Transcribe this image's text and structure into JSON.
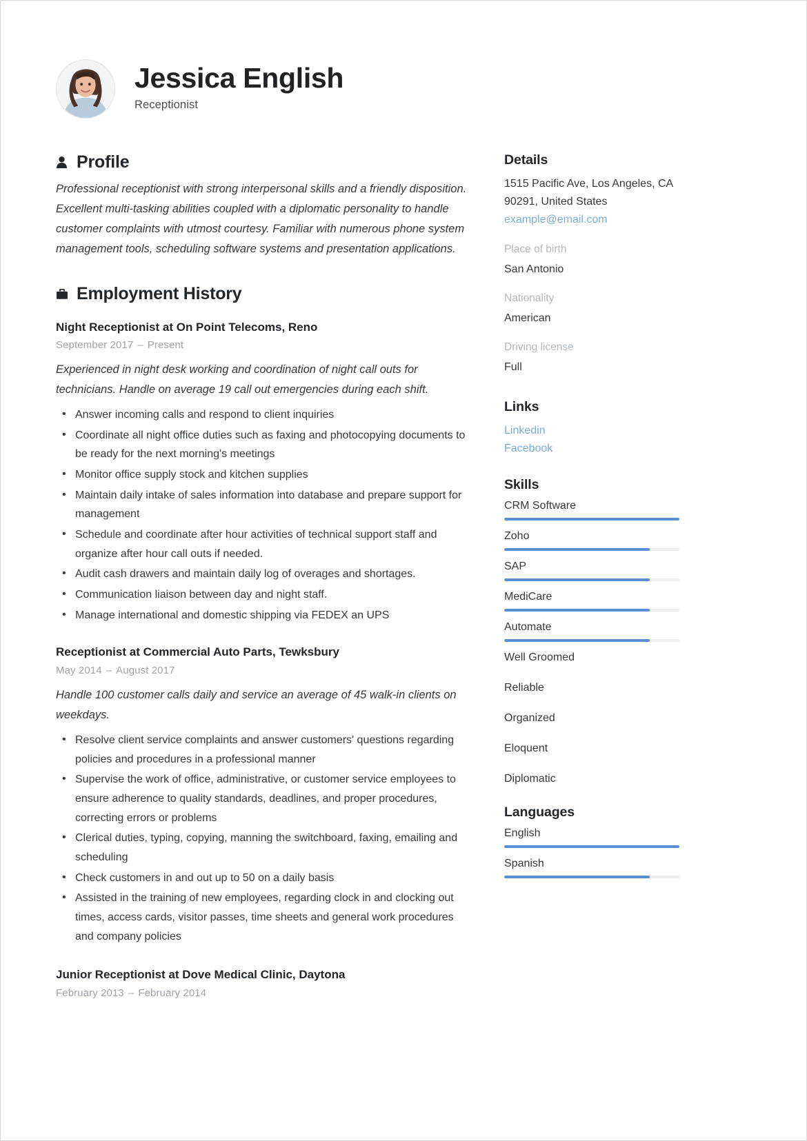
{
  "header": {
    "name": "Jessica English",
    "job_title": "Receptionist",
    "avatar_alt": "portrait-photo"
  },
  "profile": {
    "heading": "Profile",
    "icon": "person-icon",
    "text": "Professional receptionist with strong interpersonal skills and a friendly disposition. Excellent multi-tasking abilities coupled with a diplomatic personality to handle customer complaints with utmost courtesy. Familiar with numerous phone system management tools, scheduling software systems and presentation applications."
  },
  "employment": {
    "heading": "Employment History",
    "icon": "briefcase-icon",
    "jobs": [
      {
        "title": "Night Receptionist at On Point Telecoms, Reno",
        "start": "September 2017",
        "dash": "–",
        "end": "Present",
        "description": "Experienced in night desk working and coordination of night call outs for technicians. Handle on average 19 call out emergencies during each shift.",
        "duties": [
          "Answer incoming calls and respond to client inquiries",
          "Coordinate all night office duties such as faxing and photocopying documents to be ready for the next morning's meetings",
          "Monitor office supply stock and kitchen supplies",
          "Maintain daily intake of sales information into database and prepare support for management",
          "Schedule and coordinate after hour activities of technical support staff and organize after hour call outs if needed.",
          "Audit cash drawers and maintain daily log of overages and shortages.",
          "Communication liaison between day and night staff.",
          "Manage international and domestic shipping via FEDEX an UPS"
        ]
      },
      {
        "title": "Receptionist at Commercial Auto Parts, Tewksbury",
        "start": "May 2014",
        "dash": "–",
        "end": "August 2017",
        "description": "Handle 100 customer calls daily and service an average of 45 walk-in clients on weekdays.",
        "duties": [
          "Resolve client service complaints and answer customers' questions regarding policies and procedures in a professional manner",
          "Supervise the work of office, administrative, or customer service employees to ensure adherence to quality standards, deadlines, and proper procedures, correcting errors or problems",
          "Clerical duties, typing, copying, manning the switchboard, faxing, emailing and scheduling",
          "Check customers in and out up to 50 on a daily basis",
          "Assisted in the training of new employees, regarding clock in and clocking out times, access cards, visitor passes, time sheets and general work procedures and company policies"
        ]
      },
      {
        "title": "Junior Receptionist at Dove Medical Clinic, Daytona",
        "start": "February 2013",
        "dash": "–",
        "end": "February 2014",
        "description": "",
        "duties": []
      }
    ]
  },
  "details": {
    "heading": "Details",
    "address_line1": "1515 Pacific Ave, Los Angeles, CA",
    "address_line2": "90291, United States",
    "email": "example@email.com",
    "fields": [
      {
        "label": "Place of birth",
        "value": "San Antonio"
      },
      {
        "label": "Nationality",
        "value": "American"
      },
      {
        "label": "Driving license",
        "value": "Full"
      }
    ]
  },
  "links": {
    "heading": "Links",
    "items": [
      {
        "label": "Linkedin"
      },
      {
        "label": "Facebook"
      }
    ]
  },
  "skills": {
    "heading": "Skills",
    "rated": [
      {
        "label": "CRM Software",
        "level": 100
      },
      {
        "label": "Zoho",
        "level": 83
      },
      {
        "label": "SAP",
        "level": 83
      },
      {
        "label": "MediCare",
        "level": 83
      },
      {
        "label": "Automate",
        "level": 83
      }
    ],
    "plain": [
      {
        "label": "Well Groomed"
      },
      {
        "label": "Reliable"
      },
      {
        "label": "Organized"
      },
      {
        "label": "Eloquent"
      },
      {
        "label": "Diplomatic"
      }
    ]
  },
  "languages": {
    "heading": "Languages",
    "items": [
      {
        "label": "English",
        "level": 100
      },
      {
        "label": "Spanish",
        "level": 83
      }
    ]
  },
  "colors": {
    "accent": "#5b8fd4",
    "link": "#7badd8",
    "muted": "#b3b8bd",
    "text": "#34393e"
  }
}
